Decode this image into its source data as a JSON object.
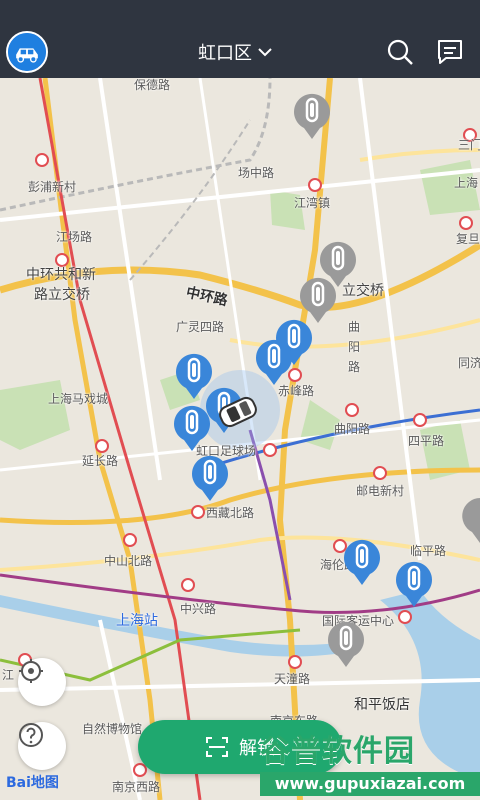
{
  "header": {
    "district": "虹口区",
    "logo_icon": "car-logo-icon",
    "search_icon": "search-icon",
    "message_icon": "message-icon"
  },
  "map": {
    "labels": [
      {
        "id": "baode",
        "text": "保德路"
      },
      {
        "id": "sanmen",
        "text": "三门"
      },
      {
        "id": "pengpu",
        "text": "彭浦新村"
      },
      {
        "id": "yangzhong",
        "text": "场中路"
      },
      {
        "id": "jiangwan",
        "text": "江湾镇"
      },
      {
        "id": "shanghai-right",
        "text": "上海"
      },
      {
        "id": "jiangchang",
        "text": "江场路"
      },
      {
        "id": "fudan",
        "text": "复旦"
      },
      {
        "id": "zhonghua1",
        "text": "中环共和新"
      },
      {
        "id": "zhonghua2",
        "text": "路立交桥"
      },
      {
        "id": "zhonghuan",
        "text": "中环路"
      },
      {
        "id": "lijiao",
        "text": "立交桥"
      },
      {
        "id": "guangling",
        "text": "广灵四路"
      },
      {
        "id": "quyang1",
        "text": "曲"
      },
      {
        "id": "quyang2",
        "text": "阳"
      },
      {
        "id": "quyang3",
        "text": "路"
      },
      {
        "id": "tongji",
        "text": "同济"
      },
      {
        "id": "chifeng",
        "text": "赤峰路"
      },
      {
        "id": "shmx",
        "text": "上海马戏城"
      },
      {
        "id": "quyanglu",
        "text": "曲阳路"
      },
      {
        "id": "sipinglu",
        "text": "四平路"
      },
      {
        "id": "hongkou",
        "text": "虹口足球场"
      },
      {
        "id": "yanchang",
        "text": "延长路"
      },
      {
        "id": "youdian",
        "text": "邮电新村"
      },
      {
        "id": "xizang",
        "text": "西藏北路"
      },
      {
        "id": "zhongshan",
        "text": "中山北路"
      },
      {
        "id": "linping",
        "text": "临平路"
      },
      {
        "id": "hailun",
        "text": "海伦路"
      },
      {
        "id": "shanghaizhan",
        "text": "上海站"
      },
      {
        "id": "zhongxing",
        "text": "中兴路"
      },
      {
        "id": "guoji",
        "text": "国际客运中心"
      },
      {
        "id": "jiang",
        "text": "江"
      },
      {
        "id": "tiantong",
        "text": "天潼路"
      },
      {
        "id": "heping",
        "text": "和平饭店"
      },
      {
        "id": "ziran",
        "text": "自然博物馆"
      },
      {
        "id": "nanjingdong",
        "text": "南京东路"
      },
      {
        "id": "nanjingxi",
        "text": "南京西路"
      }
    ],
    "baidu": "Bai地图"
  },
  "controls": {
    "locate_icon": "locate-icon",
    "help_icon": "help-icon"
  },
  "unlock": {
    "label": "解锁",
    "icon": "scan-icon"
  },
  "watermark": {
    "title": "谷普软件园",
    "url": "www.gupuxiazai.com"
  },
  "colors": {
    "header": "#2f3540",
    "pin_active": "#3a86d9",
    "pin_inactive": "#9a9a9a",
    "unlock_green": "#1fa86f"
  }
}
